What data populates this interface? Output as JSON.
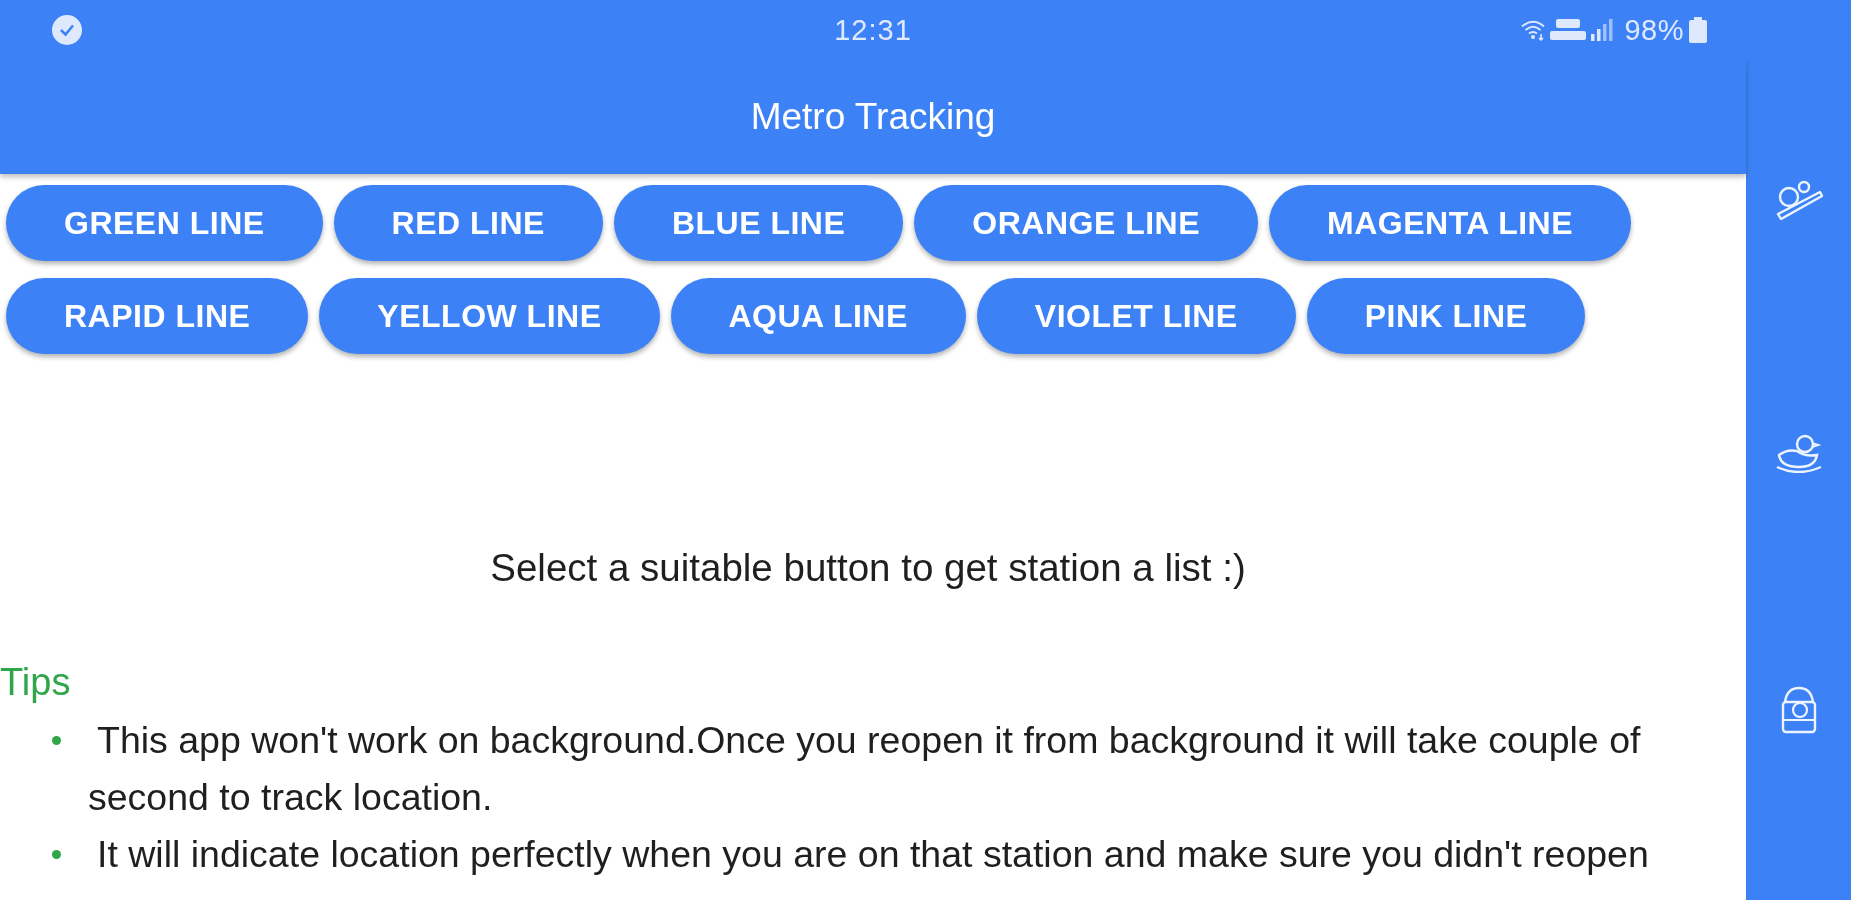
{
  "status_bar": {
    "time": "12:31",
    "battery": "98%"
  },
  "app_bar": {
    "title": "Metro Tracking"
  },
  "button_rows": [
    [
      "GREEN LINE",
      "RED LINE",
      "BLUE LINE",
      "ORANGE LINE",
      "MAGENTA LINE"
    ],
    [
      "RAPID LINE",
      "YELLOW LINE",
      "AQUA LINE",
      "VIOLET LINE",
      "PINK LINE"
    ]
  ],
  "message": "Select a suitable button to get station a list :)",
  "tips": {
    "heading": "Tips",
    "items": [
      "This app won't work on background.Once you reopen it from background it will take couple of second to track location.",
      "It will indicate location perfectly when you are on that station and make sure you didn't reopen"
    ]
  }
}
